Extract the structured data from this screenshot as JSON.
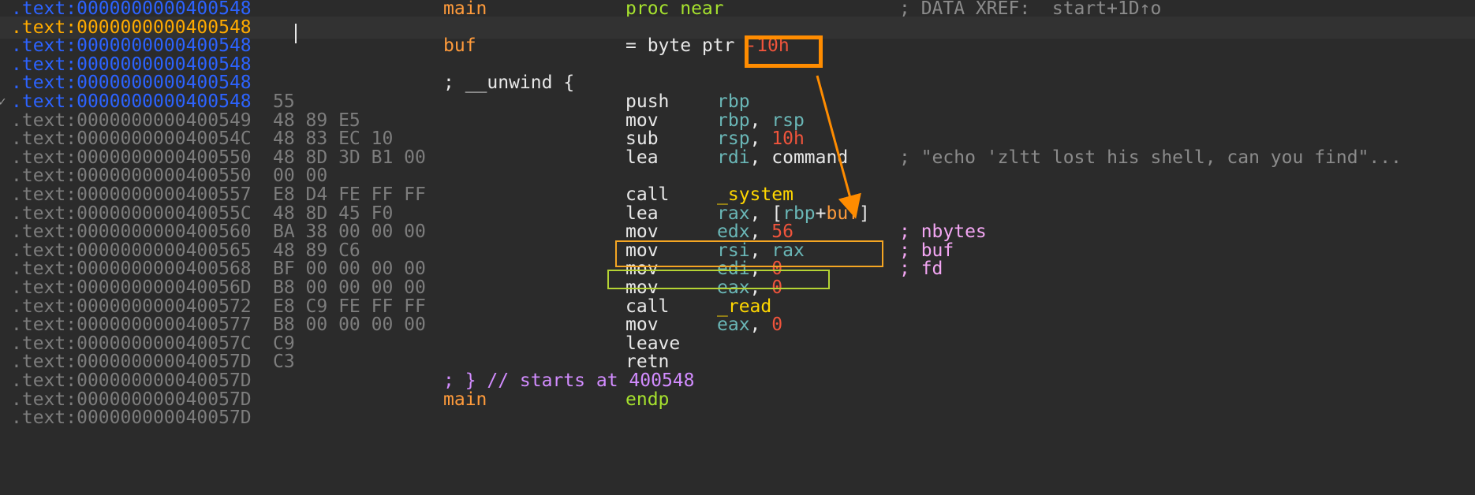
{
  "colors": {
    "background": "#2b2b2b",
    "addr_blue": "#2c63ff",
    "addr_orange": "#ffab00",
    "annotation_orange": "#ff8c00",
    "annotation_green": "#b5d334"
  },
  "lines": [
    {
      "seg": ".text:",
      "addr": "0000000000400548",
      "addr_style": "blue",
      "bytes": "",
      "name": "main",
      "name_style": "orange",
      "mnem": "",
      "ops": [
        {
          "t": "proc near",
          "s": "green"
        }
      ],
      "comment": "; DATA XREF: _start+1D↑o",
      "comment_style": "gray",
      "cut": true
    },
    {
      "seg": ".text:",
      "addr": "0000000000400548",
      "addr_style": "orange",
      "bytes": "",
      "name": "",
      "mnem": "",
      "ops": [],
      "comment": "",
      "current": true
    },
    {
      "seg": ".text:",
      "addr": "0000000000400548",
      "addr_style": "blue",
      "bytes": "",
      "name": "buf",
      "name_style": "orange",
      "mnem": "",
      "ops": [
        {
          "t": "= byte ptr ",
          "s": "white"
        },
        {
          "t": "-10h",
          "s": "red"
        }
      ],
      "comment": ""
    },
    {
      "seg": ".text:",
      "addr": "0000000000400548",
      "addr_style": "blue",
      "bytes": "",
      "name": "",
      "mnem": "",
      "ops": [],
      "comment": ""
    },
    {
      "seg": ".text:",
      "addr": "0000000000400548",
      "addr_style": "blue",
      "bytes": "",
      "name": "; __unwind {",
      "name_style": "white",
      "mnem": "",
      "ops": [],
      "comment": ""
    },
    {
      "seg": ".text:",
      "addr": "0000000000400548",
      "addr_style": "blue",
      "bytes": "55",
      "name": "",
      "mnem": "push",
      "ops": [
        {
          "t": "rbp",
          "s": "teal"
        }
      ],
      "comment": "",
      "tick": true
    },
    {
      "seg": ".text:",
      "addr": "0000000000400549",
      "addr_style": "gray",
      "bytes": "48 89 E5",
      "name": "",
      "mnem": "mov",
      "ops": [
        {
          "t": "rbp",
          "s": "teal"
        },
        {
          "t": ", ",
          "s": "white"
        },
        {
          "t": "rsp",
          "s": "teal"
        }
      ],
      "comment": ""
    },
    {
      "seg": ".text:",
      "addr": "000000000040054C",
      "addr_style": "gray",
      "bytes": "48 83 EC 10",
      "name": "",
      "mnem": "sub",
      "ops": [
        {
          "t": "rsp",
          "s": "teal"
        },
        {
          "t": ", ",
          "s": "white"
        },
        {
          "t": "10h",
          "s": "red"
        }
      ],
      "comment": ""
    },
    {
      "seg": ".text:",
      "addr": "0000000000400550",
      "addr_style": "gray",
      "bytes": "48 8D 3D B1 00",
      "name": "",
      "mnem": "lea",
      "ops": [
        {
          "t": "rdi",
          "s": "teal"
        },
        {
          "t": ", ",
          "s": "white"
        },
        {
          "t": "command",
          "s": "white"
        }
      ],
      "comment": "; \"echo 'zltt lost his shell, can you find\"...",
      "comment_style": "gray"
    },
    {
      "seg": ".text:",
      "addr": "0000000000400550",
      "addr_style": "gray",
      "bytes": "00 00",
      "name": "",
      "mnem": "",
      "ops": [],
      "comment": ""
    },
    {
      "seg": ".text:",
      "addr": "0000000000400557",
      "addr_style": "gray",
      "bytes": "E8 D4 FE FF FF",
      "name": "",
      "mnem": "call",
      "ops": [
        {
          "t": "_system",
          "s": "yellow"
        }
      ],
      "comment": ""
    },
    {
      "seg": ".text:",
      "addr": "000000000040055C",
      "addr_style": "gray",
      "bytes": "48 8D 45 F0",
      "name": "",
      "mnem": "lea",
      "ops": [
        {
          "t": "rax",
          "s": "teal"
        },
        {
          "t": ", [",
          "s": "white"
        },
        {
          "t": "rbp",
          "s": "teal"
        },
        {
          "t": "+",
          "s": "white"
        },
        {
          "t": "buf",
          "s": "orange"
        },
        {
          "t": "]",
          "s": "white"
        }
      ],
      "comment": ""
    },
    {
      "seg": ".text:",
      "addr": "0000000000400560",
      "addr_style": "gray",
      "bytes": "BA 38 00 00 00",
      "name": "",
      "mnem": "mov",
      "ops": [
        {
          "t": "edx",
          "s": "teal"
        },
        {
          "t": ", ",
          "s": "white"
        },
        {
          "t": "56",
          "s": "red"
        }
      ],
      "comment": "; nbytes",
      "comment_style": "pink"
    },
    {
      "seg": ".text:",
      "addr": "0000000000400565",
      "addr_style": "gray",
      "bytes": "48 89 C6",
      "name": "",
      "mnem": "mov",
      "ops": [
        {
          "t": "rsi",
          "s": "teal"
        },
        {
          "t": ", ",
          "s": "white"
        },
        {
          "t": "rax",
          "s": "teal"
        }
      ],
      "comment": "; buf",
      "comment_style": "pink"
    },
    {
      "seg": ".text:",
      "addr": "0000000000400568",
      "addr_style": "gray",
      "bytes": "BF 00 00 00 00",
      "name": "",
      "mnem": "mov",
      "ops": [
        {
          "t": "edi",
          "s": "teal"
        },
        {
          "t": ", ",
          "s": "white"
        },
        {
          "t": "0",
          "s": "red"
        }
      ],
      "comment": "; fd",
      "comment_style": "pink"
    },
    {
      "seg": ".text:",
      "addr": "000000000040056D",
      "addr_style": "gray",
      "bytes": "B8 00 00 00 00",
      "name": "",
      "mnem": "mov",
      "ops": [
        {
          "t": "eax",
          "s": "teal"
        },
        {
          "t": ", ",
          "s": "white"
        },
        {
          "t": "0",
          "s": "red"
        }
      ],
      "comment": ""
    },
    {
      "seg": ".text:",
      "addr": "0000000000400572",
      "addr_style": "gray",
      "bytes": "E8 C9 FE FF FF",
      "name": "",
      "mnem": "call",
      "ops": [
        {
          "t": "_read",
          "s": "yellow"
        }
      ],
      "comment": ""
    },
    {
      "seg": ".text:",
      "addr": "0000000000400577",
      "addr_style": "gray",
      "bytes": "B8 00 00 00 00",
      "name": "",
      "mnem": "mov",
      "ops": [
        {
          "t": "eax",
          "s": "teal"
        },
        {
          "t": ", ",
          "s": "white"
        },
        {
          "t": "0",
          "s": "red"
        }
      ],
      "comment": ""
    },
    {
      "seg": ".text:",
      "addr": "000000000040057C",
      "addr_style": "gray",
      "bytes": "C9",
      "name": "",
      "mnem": "leave",
      "ops": [],
      "comment": ""
    },
    {
      "seg": ".text:",
      "addr": "000000000040057D",
      "addr_style": "gray",
      "bytes": "C3",
      "name": "",
      "mnem": "retn",
      "ops": [],
      "comment": ""
    },
    {
      "seg": ".text:",
      "addr": "000000000040057D",
      "addr_style": "gray",
      "bytes": "",
      "name": "; } // starts at 400548",
      "name_style": "purple",
      "mnem": "",
      "ops": [],
      "comment": ""
    },
    {
      "seg": ".text:",
      "addr": "000000000040057D",
      "addr_style": "gray",
      "bytes": "",
      "name": "main",
      "name_style": "orange",
      "mnem": "",
      "ops": [
        {
          "t": "endp",
          "s": "green"
        }
      ],
      "comment": ""
    },
    {
      "seg": ".text:",
      "addr": "000000000040057D",
      "addr_style": "gray",
      "bytes": "",
      "name": "",
      "mnem": "",
      "ops": [],
      "comment": ""
    }
  ],
  "annotations": {
    "box_offset": "-10h operand highlight",
    "box_lea": "lea rax, [rbp+buf] highlight",
    "box_mov": "mov edx, 56 highlight"
  }
}
